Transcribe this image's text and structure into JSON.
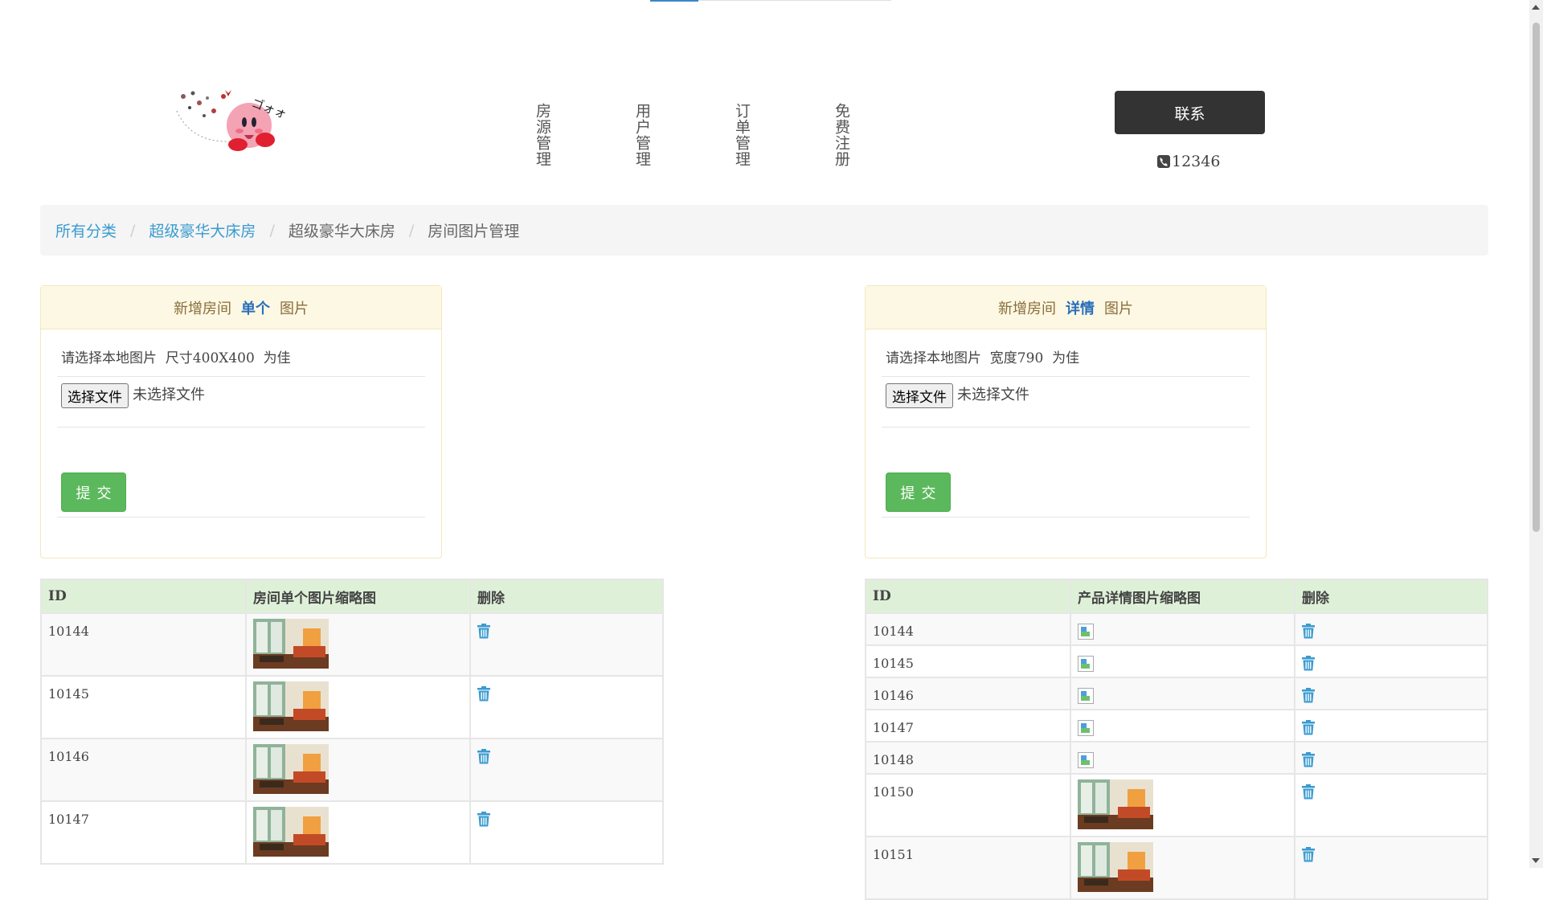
{
  "header": {
    "nav": [
      {
        "label": "房源管理"
      },
      {
        "label": "用户管理"
      },
      {
        "label": "订单管理"
      },
      {
        "label": "免费注册"
      }
    ],
    "contact_label": "联系",
    "phone": "12346"
  },
  "breadcrumb": [
    "所有分类",
    "超级豪华大床房",
    "超级豪华大床房",
    "房间图片管理"
  ],
  "panels": {
    "single": {
      "title_pre": "新增房间",
      "title_strong": "单个",
      "title_post": "图片",
      "hint": "请选择本地图片  尺寸400X400  为佳",
      "file_button": "选择文件",
      "file_status": "未选择文件",
      "submit": "提交"
    },
    "detail": {
      "title_pre": "新增房间",
      "title_strong": "详情",
      "title_post": "图片",
      "hint": "请选择本地图片  宽度790  为佳",
      "file_button": "选择文件",
      "file_status": "未选择文件",
      "submit": "提交"
    }
  },
  "single_table": {
    "headers": [
      "ID",
      "房间单个图片缩略图",
      "删除"
    ],
    "rows": [
      {
        "id": "10144"
      },
      {
        "id": "10145"
      },
      {
        "id": "10146"
      },
      {
        "id": "10147"
      }
    ]
  },
  "detail_table": {
    "headers": [
      "ID",
      "产品详情图片缩略图",
      "删除"
    ],
    "rows": [
      {
        "id": "10144",
        "image": "broken"
      },
      {
        "id": "10145",
        "image": "broken"
      },
      {
        "id": "10146",
        "image": "broken"
      },
      {
        "id": "10147",
        "image": "broken"
      },
      {
        "id": "10148",
        "image": "broken"
      },
      {
        "id": "10150",
        "image": "thumb"
      },
      {
        "id": "10151",
        "image": "thumb"
      }
    ]
  },
  "icons": {
    "phone": "phone-icon",
    "delete": "trash-icon"
  },
  "colors": {
    "accent": "#3a9bd0",
    "success": "#5cb85c",
    "panel_header": "#fcf8e3",
    "table_header": "#dff0d8",
    "contact": "#333333"
  }
}
